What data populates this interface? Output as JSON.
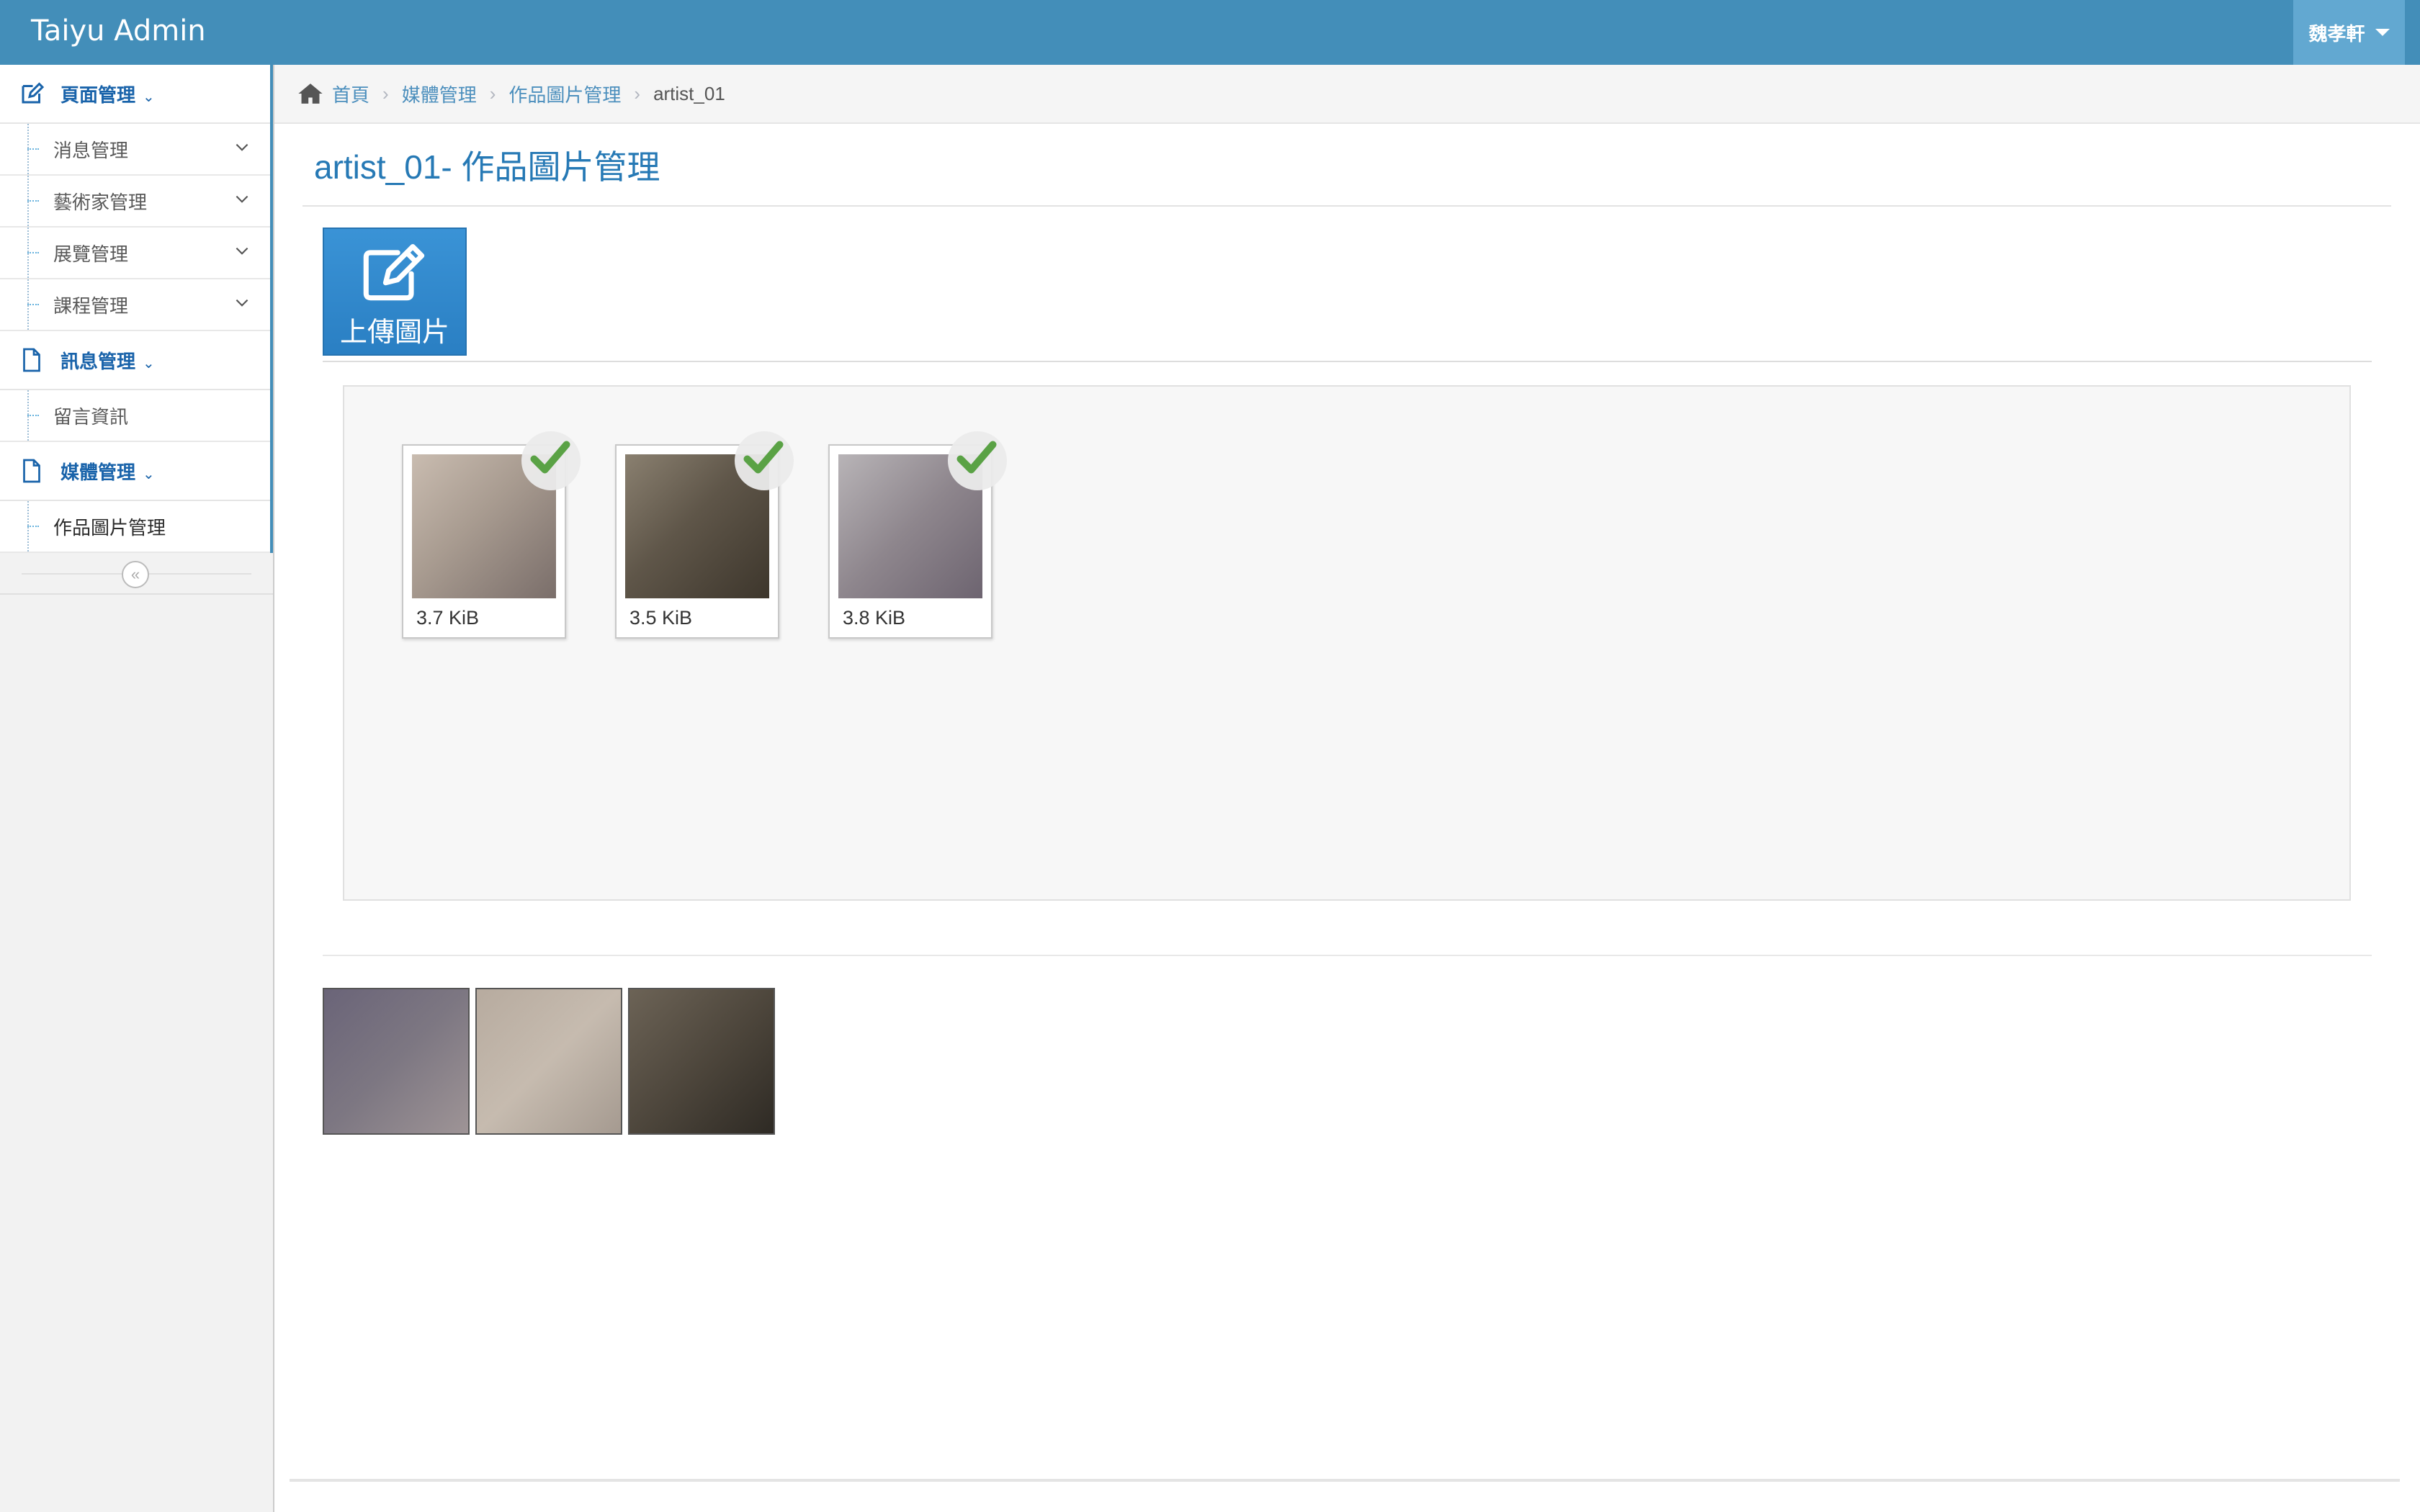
{
  "app": {
    "brand": "Taiyu Admin",
    "user_name": "魏孝軒"
  },
  "sidebar": {
    "groups": [
      {
        "label": "頁面管理",
        "icon": "edit-icon",
        "items": [
          {
            "label": "消息管理"
          },
          {
            "label": "藝術家管理"
          },
          {
            "label": "展覽管理"
          },
          {
            "label": "課程管理"
          }
        ]
      },
      {
        "label": "訊息管理",
        "icon": "file-icon",
        "items": [
          {
            "label": "留言資訊"
          }
        ]
      },
      {
        "label": "媒體管理",
        "icon": "file-icon",
        "items": [
          {
            "label": "作品圖片管理"
          }
        ]
      }
    ],
    "collapse_glyph": "«"
  },
  "breadcrumbs": {
    "home": "首頁",
    "media": "媒體管理",
    "works": "作品圖片管理",
    "current": "artist_01"
  },
  "page": {
    "title": "artist_01- 作品圖片管理"
  },
  "upload": {
    "label": "上傳圖片"
  },
  "dropzone": {
    "previews": [
      {
        "size": "3.7 KiB",
        "status": "uploaded"
      },
      {
        "size": "3.5 KiB",
        "status": "uploaded"
      },
      {
        "size": "3.8 KiB",
        "status": "uploaded"
      }
    ]
  },
  "colors": {
    "navbar": "#438eb9",
    "accent": "#2679b5",
    "success": "#5aa245",
    "upload_button": "#2a86cc"
  }
}
